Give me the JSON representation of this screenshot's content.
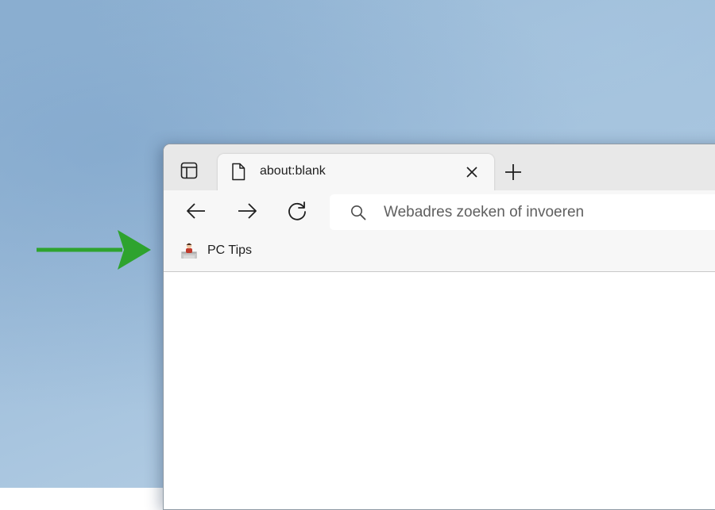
{
  "colors": {
    "annotation_arrow": "#2ea32e",
    "tabstrip_bg": "#e8e8e8",
    "toolbar_bg": "#f7f7f7",
    "address_bar_bg": "#ffffff"
  },
  "tab_strip": {
    "tab_actions_icon": "vertical-tabs-icon",
    "tabs": [
      {
        "title": "about:blank",
        "icon": "blank-page-icon",
        "close_icon": "close-icon"
      }
    ],
    "new_tab_icon": "plus-icon"
  },
  "toolbar": {
    "back_icon": "arrow-left-icon",
    "forward_icon": "arrow-right-icon",
    "refresh_icon": "refresh-icon",
    "address_bar": {
      "icon": "search-icon",
      "placeholder": "Webadres zoeken of invoeren",
      "value": ""
    }
  },
  "favorites_bar": {
    "items": [
      {
        "label": "PC Tips",
        "icon": "pc-tips-favicon"
      }
    ]
  },
  "annotation": {
    "icon": "green-arrow-right-icon"
  }
}
